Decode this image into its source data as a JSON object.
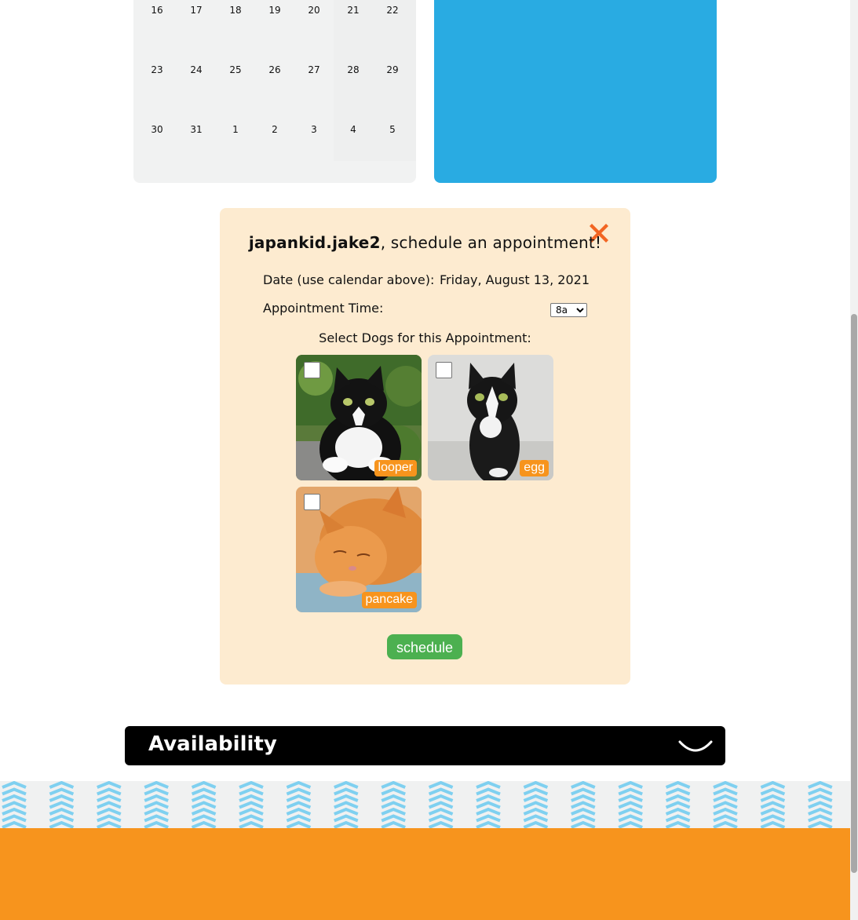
{
  "calendar": {
    "weeks": [
      [
        "16",
        "17",
        "18",
        "19",
        "20",
        "21",
        "22"
      ],
      [
        "23",
        "24",
        "25",
        "26",
        "27",
        "28",
        "29"
      ],
      [
        "30",
        "31",
        "1",
        "2",
        "3",
        "4",
        "5"
      ]
    ]
  },
  "appointment": {
    "username": "japankid.jake2",
    "title_suffix": ", schedule an appointment!",
    "date_label": "Date (use calendar above):",
    "date_value": "Friday, August 13, 2021",
    "time_label": "Appointment Time:",
    "time_selected": "8a",
    "dogs_heading": "Select Dogs for this Appointment:",
    "dogs": [
      {
        "name": "looper",
        "checked": false
      },
      {
        "name": "egg",
        "checked": false
      },
      {
        "name": "pancake",
        "checked": false
      }
    ],
    "schedule_label": "schedule",
    "close_icon": "close-x-icon",
    "colors": {
      "close": "#f26522",
      "panel": "#fdebd0",
      "tag": "#f7941d",
      "button": "#4cb050"
    }
  },
  "availability": {
    "title": "Availability",
    "icon": "chevron-down-icon"
  },
  "colors": {
    "blue_panel": "#29abe2",
    "footer": "#f7941d",
    "pattern": "#7fd0f0"
  }
}
